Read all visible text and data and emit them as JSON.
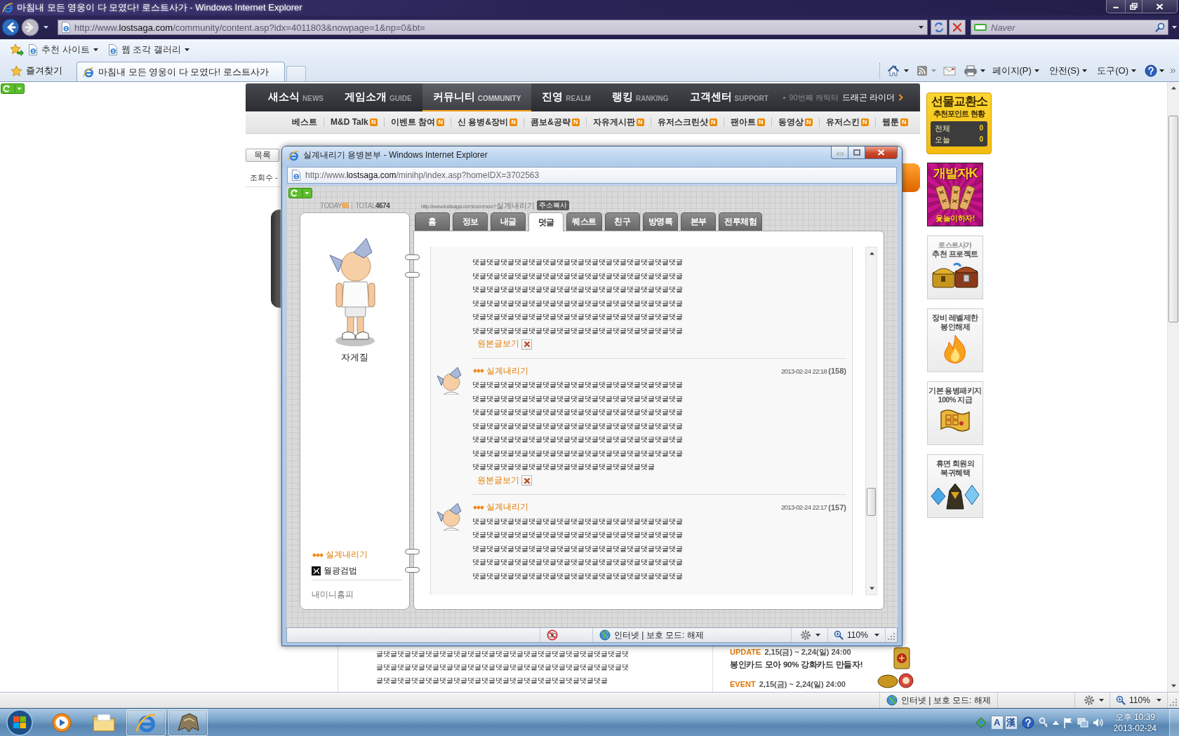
{
  "window": {
    "title": "마침내 모든 영웅이 다 모였다! 로스트사가 - Windows Internet Explorer"
  },
  "address_bar": {
    "url": "http://www.lostsaga.com/community/content.asp?idx=4011803&nowpage=1&np=0&bt=",
    "search": {
      "placeholder": "Naver"
    }
  },
  "favorites_bar": {
    "items": [
      {
        "label": "추천 사이트"
      },
      {
        "label": "웹 조각 갤러리"
      }
    ]
  },
  "tab_row": {
    "favorites_button": "즐겨찾기",
    "tabs": [
      {
        "label": "마침내 모든 영웅이 다 모였다! 로스트사가",
        "selected": true
      }
    ],
    "menus": [
      {
        "label": "페이지(P)"
      },
      {
        "label": "안전(S)"
      },
      {
        "label": "도구(O)"
      }
    ]
  },
  "site_nav": {
    "items": [
      {
        "label": "새소식",
        "sub": "NEWS",
        "selected": false
      },
      {
        "label": "게임소개",
        "sub": "GUIDE",
        "selected": false
      },
      {
        "label": "커뮤니티",
        "sub": "COMMUNITY",
        "selected": true
      },
      {
        "label": "진영",
        "sub": "REALM",
        "selected": false
      },
      {
        "label": "랭킹",
        "sub": "RANKING",
        "selected": false
      },
      {
        "label": "고객센터",
        "sub": "SUPPORT",
        "selected": false
      }
    ],
    "notice": {
      "text": "90번째 캐릭터",
      "link": "드래곤 라이더"
    }
  },
  "sub_nav": {
    "items": [
      {
        "label": "베스트"
      },
      {
        "label": "M&D Talk",
        "badge": "N"
      },
      {
        "label": "이벤트 참여",
        "badge": "N"
      },
      {
        "label": "신 용병&장비",
        "badge": "N"
      },
      {
        "label": "콤보&공략",
        "badge": "N"
      },
      {
        "label": "자유게시판",
        "badge": "N"
      },
      {
        "label": "유저스크린샷",
        "badge": "N"
      },
      {
        "label": "팬아트",
        "badge": "N"
      },
      {
        "label": "동영상",
        "badge": "N"
      },
      {
        "label": "유저스킨",
        "badge": "N"
      },
      {
        "label": "웹툰",
        "badge": "N"
      }
    ]
  },
  "article": {
    "list_button": "목록",
    "views": "조회수 -",
    "body": "글댓글댓글댓글댓글댓글댓글댓글댓글댓글댓글댓글댓글댓글댓글댓글댓글댓글댓글댓글댓글댓글댓글댓글댓글댓글댓글댓글댓글댓글댓글댓글댓글댓글댓글댓글댓글댓글댓글댓글댓글댓글댓글댓글댓글댓글댓글댓글댓글댓글댓글댓글댓글",
    "event_banner": {
      "lines": [
        {
          "kind": "event",
          "tag": "UPDATE",
          "period": "2,15(금) ~ 2,24(일) 24:00"
        },
        {
          "kind": "headline",
          "text": "봉인카드 모아 90% 강화카드 만들자!"
        },
        {
          "kind": "event",
          "tag": "EVENT",
          "period": "2,15(금) ~ 2,24(일) 24:00"
        }
      ]
    }
  },
  "sidebar": {
    "points": {
      "title": "선물교환소",
      "subtitle": "추천포인트 현황",
      "rows": [
        {
          "label": "전체",
          "value": "0"
        },
        {
          "label": "오늘",
          "value": "0"
        }
      ]
    },
    "banners": [
      {
        "kind": "yut",
        "lines": [
          "개발자K",
          "윷놀이하자!"
        ]
      },
      {
        "kind": "chests",
        "lines": [
          "로스트사가",
          "추천 프로젝트"
        ]
      },
      {
        "kind": "flame",
        "lines": [
          "장비 레벨제한",
          "봉인해제"
        ]
      },
      {
        "kind": "scroll",
        "lines": [
          "기본 용병패키지",
          "100% 지급"
        ]
      },
      {
        "kind": "crystals",
        "lines": [
          "휴면 회원의",
          "복귀혜택"
        ]
      }
    ]
  },
  "popup": {
    "title": "실계내리기 용병본부 - Windows Internet Explorer",
    "url": "http://www.lostsaga.com/minihp/index.asp?homeIDX=3702563",
    "counter": {
      "today_label": "TODAY",
      "today": "65",
      "total_label": "TOTAL",
      "total": "4674"
    },
    "home_url": "http://www.lostsaga.com/common/?실계내리기",
    "copy_button": "주소복사",
    "profile": {
      "name": "자게질",
      "owner": "실계내리기",
      "skill": "월광검법",
      "my_home": "내미니홈피"
    },
    "tabs": [
      {
        "label": "홈",
        "selected": false
      },
      {
        "label": "정보",
        "selected": false
      },
      {
        "label": "내글",
        "selected": false
      },
      {
        "label": "덧글",
        "selected": true
      },
      {
        "label": "퀘스트",
        "selected": false
      },
      {
        "label": "친구",
        "selected": false
      },
      {
        "label": "방명록",
        "selected": false
      },
      {
        "label": "본부",
        "selected": false
      },
      {
        "label": "전투체험",
        "selected": false
      }
    ],
    "comments": [
      {
        "body": "댓글댓글댓글댓글댓글댓글댓글댓글댓글댓글댓글댓글댓글댓글댓글댓글댓글댓글댓글댓글댓글댓글댓글댓글댓글댓글댓글댓글댓글댓글댓글댓글댓글댓글댓글댓글댓글댓글댓글댓글댓글댓글댓글댓글댓글댓글댓글댓글댓글댓글댓글댓글댓글댓글댓글댓글댓글댓글댓글댓글댓글댓글댓글댓글댓글댓글댓글댓글댓글댓글댓글댓글댓글댓글댓글댓글댓글댓글댓글댓글댓글댓글댓글댓글댓글댓글댓글댓글댓글댓글",
        "link": "원본글보기",
        "deletable": true
      },
      {
        "author": "실계내리기",
        "date": "2013-02-24 22:18",
        "count": "(158)",
        "body": "댓글댓글댓글댓글댓글댓글댓글댓글댓글댓글댓글댓글댓글댓글댓글댓글댓글댓글댓글댓글댓글댓글댓글댓글댓글댓글댓글댓글댓글댓글댓글댓글댓글댓글댓글댓글댓글댓글댓글댓글댓글댓글댓글댓글댓글댓글댓글댓글댓글댓글댓글댓글댓글댓글댓글댓글댓글댓글댓글댓글댓글댓글댓글댓글댓글댓글댓글댓글댓글댓글댓글댓글댓글댓글댓글댓글댓글댓글댓글댓글댓글댓글댓글댓글댓글댓글댓글댓글댓글댓글댓글댓글댓글댓글댓글댓글댓글댓글댓글댓글댓글댓글댓글",
        "link": "원본글보기",
        "deletable": true
      },
      {
        "author": "실계내리기",
        "date": "2013-02-24 22:17",
        "count": "(157)",
        "body": "댓글댓글댓글댓글댓글댓글댓글댓글댓글댓글댓글댓글댓글댓글댓글댓글댓글댓글댓글댓글댓글댓글댓글댓글댓글댓글댓글댓글댓글댓글댓글댓글댓글댓글댓글댓글댓글댓글댓글댓글댓글댓글댓글댓글댓글댓글댓글댓글댓글댓글댓글댓글댓글댓글댓글댓글댓글댓글댓글댓글댓글댓글댓글댓글댓글댓글댓글댓글댓글댓글댓글댓글댓글댓글댓글"
      }
    ],
    "status": {
      "zone": "인터넷 | 보호 모드: 해제",
      "zoom": "110%"
    }
  },
  "status_bar": {
    "zone": "인터넷 | 보호 모드: 해제",
    "zoom": "110%"
  },
  "taskbar": {
    "apps": [
      {
        "kind": "media",
        "running": false
      },
      {
        "kind": "folder",
        "running": false
      },
      {
        "kind": "browser",
        "running": true
      },
      {
        "kind": "game",
        "running": true
      }
    ],
    "ime": [
      "A",
      "漢"
    ],
    "time": "오후 10:39",
    "date": "2013-02-24"
  }
}
